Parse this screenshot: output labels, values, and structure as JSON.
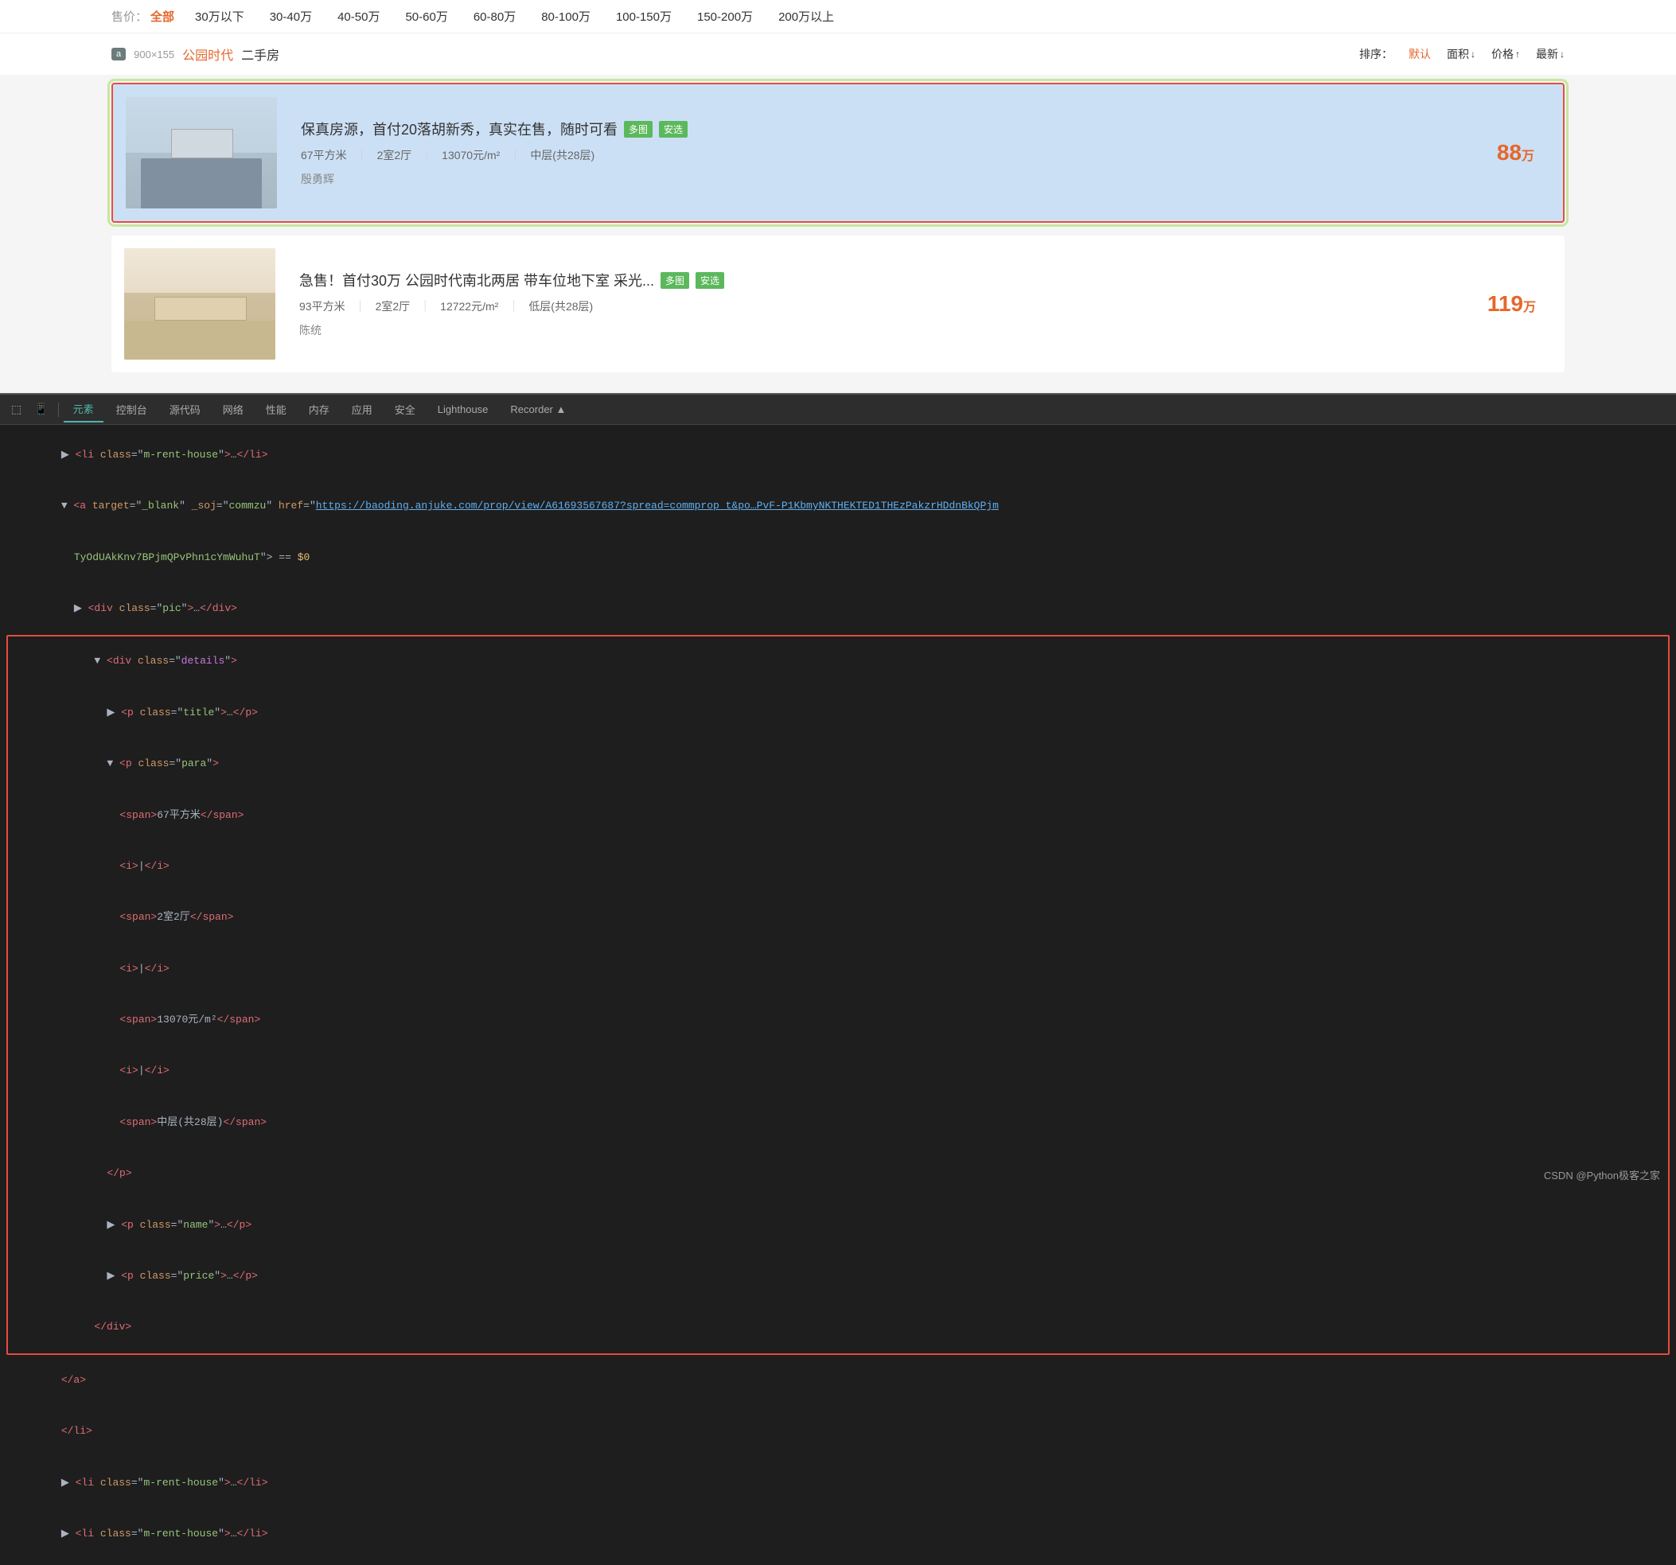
{
  "filterBar": {
    "label": "售价：",
    "activeFilter": "全部",
    "items": [
      "30万以下",
      "30-40万",
      "40-50万",
      "50-60万",
      "60-80万",
      "80-100万",
      "100-150万",
      "150-200万",
      "200万以上"
    ]
  },
  "searchHeader": {
    "sizeBadge": "a",
    "sizeLabel": "900×155",
    "keyword": "公园时代",
    "keywordSuffix": "二手房",
    "sortLabel": "排序：",
    "sortDefault": "默认",
    "sortArea": "面积",
    "sortPrice": "价格",
    "sortLatest": "最新"
  },
  "listings": [
    {
      "id": "listing-1",
      "featured": true,
      "title": "保真房源，首付20落胡新秀，真实在售，随时可看",
      "tags": [
        "多图",
        "安选"
      ],
      "area": "67平方米",
      "rooms": "2室2厅",
      "unitPrice": "13070元/m²",
      "floor": "中层(共28层)",
      "agent": "殷勇辉",
      "price": "88",
      "priceUnit": "万"
    },
    {
      "id": "listing-2",
      "featured": false,
      "title": "急售！首付30万 公园时代南北两居 带车位地下室 采光...",
      "tags": [
        "多图",
        "安选"
      ],
      "area": "93平方米",
      "rooms": "2室2厅",
      "unitPrice": "12722元/m²",
      "floor": "低层(共28层)",
      "agent": "陈统",
      "price": "119",
      "priceUnit": "万"
    }
  ],
  "devtools": {
    "tabs": [
      {
        "id": "elements",
        "label": "元素",
        "active": true
      },
      {
        "id": "console",
        "label": "控制台",
        "active": false
      },
      {
        "id": "sources",
        "label": "源代码",
        "active": false
      },
      {
        "id": "network",
        "label": "网络",
        "active": false
      },
      {
        "id": "performance",
        "label": "性能",
        "active": false
      },
      {
        "id": "memory",
        "label": "内存",
        "active": false
      },
      {
        "id": "application",
        "label": "应用",
        "active": false
      },
      {
        "id": "security",
        "label": "安全",
        "active": false
      },
      {
        "id": "lighthouse",
        "label": "Lighthouse",
        "active": false
      },
      {
        "id": "recorder",
        "label": "Recorder ▲",
        "active": false
      }
    ],
    "code": {
      "line1": "<li class=\"m-rent-house\">…</li>",
      "line2_pre": "<a target=\"_blank\" _soj=\"commzu\" href=\"",
      "line2_link": "https://baoding.anjuke.com/prop/view/A61693567687?spread=commprop_t&po…PvF-P1KbmyNKTHEKTED1THEzPakzrHDdnBkQPjm",
      "line2_post": "TyOdUAkKnv7BPjmQPvPhn1cYmWuhuT\"> == $0",
      "line3": "▶ <div class=\"pic\">…</div>",
      "line4_open": "▼ <div class=\"details\">",
      "line5": "  ▶ <p class=\"title\">…</p>",
      "line6_open": "  ▼ <p class=\"para\">",
      "line7": "      <span>67平方米</span>",
      "line8": "      <i>|</i>",
      "line8b": "      <span>2室2厅</span>",
      "line9": "      <i>|</i>",
      "line9b": "      <span>13070元/m²</span>",
      "line10": "      <i>|</i>",
      "line10b": "      <span>中层(共28层)</span>",
      "line11": "    </p>",
      "line12": "  ▶ <p class=\"name\">…</p>",
      "line13": "  ▶ <p class=\"price\">…</p>",
      "line14": "</div>",
      "line15": "</a>",
      "line16": "</li>",
      "line17": "▶ <li class=\"m-rent-house\">…</li>",
      "line18": "▶ <li class=\"m-rent-house\">…</li>"
    },
    "watermark": "CSDN @Python极客之家"
  }
}
